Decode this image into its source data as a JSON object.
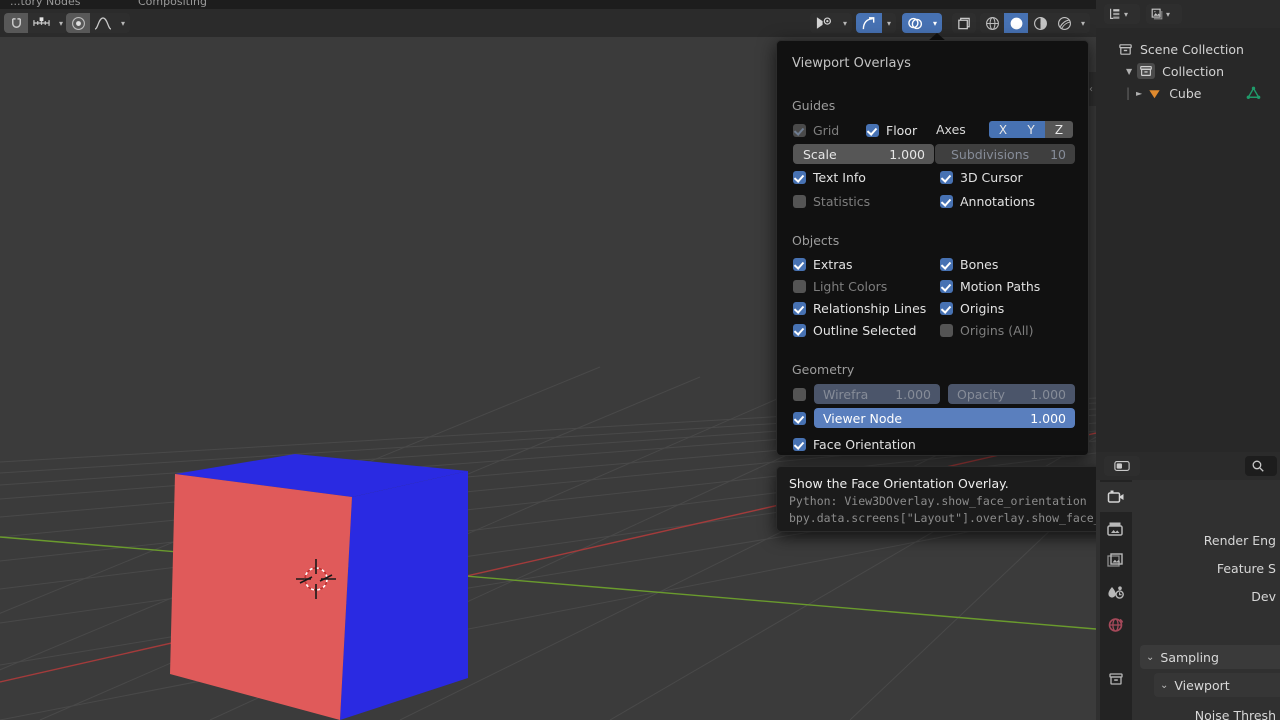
{
  "app": "Blender",
  "menubar": {
    "cut_items": [
      "...tory Nodes",
      "Compositing"
    ]
  },
  "viewport_header": {
    "snap_magnet": "magnet-icon",
    "snap_to": "snap-increment-icon",
    "proportional": "proportional-edit-icon",
    "falloff": "smooth-falloff-icon",
    "visibility": "object-visibility-icon",
    "gizmo": "gizmo-icon",
    "overlays": "overlays-icon",
    "xray": "toggle-xray-icon",
    "shading_wireframe": "shading-wireframe-icon",
    "shading_solid": "shading-solid-icon",
    "shading_material": "shading-material-preview-icon",
    "shading_rendered": "shading-rendered-icon"
  },
  "sidebar_toggle": "‹",
  "overlays": {
    "title": "Viewport Overlays",
    "sections": {
      "guides": "Guides",
      "objects": "Objects",
      "geometry": "Geometry"
    },
    "guides": {
      "grid": {
        "label": "Grid",
        "checked": true,
        "enabled": false
      },
      "floor": {
        "label": "Floor",
        "checked": true,
        "enabled": true
      },
      "axes_label": "Axes",
      "axes": [
        {
          "label": "X",
          "active": true
        },
        {
          "label": "Y",
          "active": true
        },
        {
          "label": "Z",
          "active": false
        }
      ],
      "scale": {
        "label": "Scale",
        "value": "1.000",
        "enabled": true
      },
      "subdivisions": {
        "label": "Subdivisions",
        "value": "10",
        "enabled": false
      },
      "text_info": {
        "label": "Text Info",
        "checked": true,
        "enabled": true
      },
      "cursor_3d": {
        "label": "3D Cursor",
        "checked": true,
        "enabled": true
      },
      "statistics": {
        "label": "Statistics",
        "checked": false,
        "enabled": false
      },
      "annotations": {
        "label": "Annotations",
        "checked": true,
        "enabled": true
      }
    },
    "objects": {
      "extras": {
        "label": "Extras",
        "checked": true,
        "enabled": true
      },
      "bones": {
        "label": "Bones",
        "checked": true,
        "enabled": true
      },
      "light_colors": {
        "label": "Light Colors",
        "checked": false,
        "enabled": false
      },
      "motion_paths": {
        "label": "Motion Paths",
        "checked": true,
        "enabled": true
      },
      "relationship_lines": {
        "label": "Relationship Lines",
        "checked": true,
        "enabled": true
      },
      "origins": {
        "label": "Origins",
        "checked": true,
        "enabled": true
      },
      "outline_selected": {
        "label": "Outline Selected",
        "checked": true,
        "enabled": true
      },
      "origins_all": {
        "label": "Origins (All)",
        "checked": false,
        "enabled": false
      }
    },
    "geometry": {
      "wireframe_toggle": {
        "checked": false,
        "enabled": true
      },
      "wireframe": {
        "label": "Wirefra",
        "value": "1.000",
        "enabled": false
      },
      "opacity": {
        "label": "Opacity",
        "value": "1.000",
        "enabled": false
      },
      "viewer_node_toggle": {
        "checked": true
      },
      "viewer_node": {
        "label": "Viewer Node",
        "value": "1.000"
      },
      "face_orientation": {
        "label": "Face Orientation",
        "checked": true,
        "enabled": true
      }
    }
  },
  "tooltip": {
    "headline": "Show the Face Orientation Overlay.",
    "python": "Python: View3DOverlay.show_face_orientation",
    "path": "bpy.data.screens[\"Layout\"].overlay.show_face_orientation"
  },
  "outliner": {
    "display_mode": "view-layer-icon",
    "filter": "filter-icon",
    "search": "search-icon",
    "rows": [
      {
        "label": "Scene Collection",
        "icon": "collection-icon",
        "depth": 0,
        "expander": ""
      },
      {
        "label": "Collection",
        "icon": "collection-icon",
        "depth": 1,
        "expander": "▼"
      },
      {
        "label": "Cube",
        "icon": "mesh-data-icon",
        "depth": 2,
        "expander": "►"
      }
    ]
  },
  "properties": {
    "editor_icon": "properties-editor-icon",
    "search": "search-icon",
    "tabs": [
      {
        "name": "render-tab",
        "icon": "camera-back-icon",
        "active": true
      },
      {
        "name": "output-tab",
        "icon": "printer-icon",
        "active": false
      },
      {
        "name": "view-layer-tab",
        "icon": "images-icon",
        "active": false
      },
      {
        "name": "scene-tab",
        "icon": "scene-cone-icon",
        "active": false
      },
      {
        "name": "world-tab",
        "icon": "world-globe-icon",
        "active": false
      },
      {
        "name": "collection-tab",
        "icon": "collection-icon",
        "active": false
      }
    ],
    "fields": [
      {
        "label": "Render Eng"
      },
      {
        "label": "Feature S"
      },
      {
        "label": "Dev"
      }
    ],
    "panels": [
      {
        "label": "Sampling",
        "expander": "⌄",
        "depth": 0
      },
      {
        "label": "Viewport",
        "expander": "⌄",
        "depth": 1
      }
    ],
    "bottom_field": "Noise Thresh"
  },
  "scene": {
    "object": "Cube",
    "face_orientation_front": "#2a2ae2",
    "face_orientation_back": "#e05a5a",
    "viewport_bg": "#3b3b3b",
    "axis_x_color": "#a33b3b",
    "axis_y_color": "#6a9b2d",
    "cursor_3d": "3d-cursor-icon"
  },
  "colors": {
    "accent_blue": "#4772b3",
    "panel_bg": "#111111",
    "header_bg": "#2b2b2b",
    "editor_bg": "#303030"
  }
}
